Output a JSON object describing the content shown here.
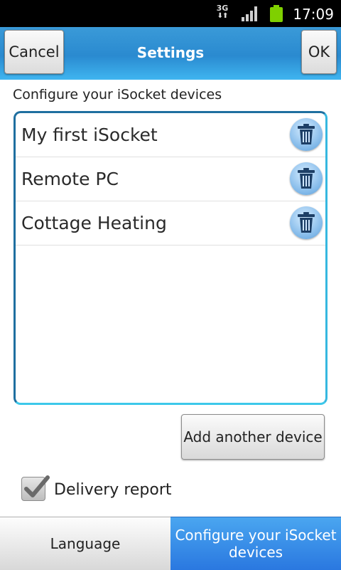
{
  "status_bar": {
    "network": "3G",
    "time": "17:09"
  },
  "title_bar": {
    "cancel_label": "Cancel",
    "title": "Settings",
    "ok_label": "OK"
  },
  "devices_section": {
    "label": "Configure your iSocket devices",
    "devices": [
      {
        "name": "My first iSocket"
      },
      {
        "name": "Remote PC"
      },
      {
        "name": "Cottage Heating"
      }
    ],
    "add_button_label": "Add another device"
  },
  "delivery_report": {
    "label": "Delivery report",
    "checked": true
  },
  "tabs": {
    "language_label": "Language",
    "configure_label": "Configure your iSocket devices"
  },
  "colors": {
    "accent": "#2a8ad0",
    "list_border": "#36b8e0",
    "active_tab": "#2a78e0"
  },
  "icons": {
    "delete": "trash-icon",
    "check": "checkmark-icon"
  }
}
